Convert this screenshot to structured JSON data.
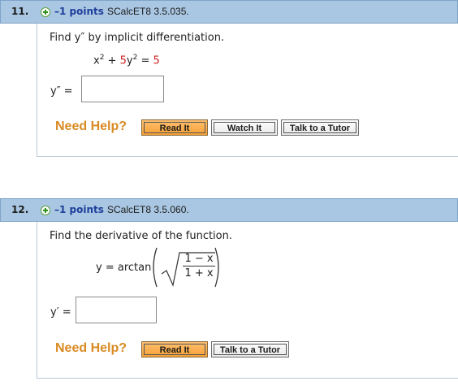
{
  "questions": [
    {
      "number": "11.",
      "points": "–1 points",
      "source": "SCalcET8 3.5.035.",
      "prompt": "Find y″ by implicit differentiation.",
      "equation": {
        "t1": "x",
        "e1": "2",
        "plus": "+",
        "coef": "5",
        "t2": "y",
        "e2": "2",
        "eq": "=",
        "rhs": "5"
      },
      "answer_label": "y″ =",
      "need_help": "Need Help?",
      "buttons": [
        "Read It",
        "Watch It",
        "Talk to a Tutor"
      ]
    },
    {
      "number": "12.",
      "points": "–1 points",
      "source": "SCalcET8 3.5.060.",
      "prompt": "Find the derivative of the function.",
      "equation": {
        "lhs": "y = arctan",
        "num": "1 − x",
        "den": "1 + x"
      },
      "answer_label": "y′ =",
      "need_help": "Need Help?",
      "buttons": [
        "Read It",
        "Talk to a Tutor"
      ]
    }
  ],
  "colors": {
    "header": "#a9c7e2",
    "points": "#1f3f9a",
    "need_help": "#d98a22",
    "math_red": "#d02020"
  }
}
